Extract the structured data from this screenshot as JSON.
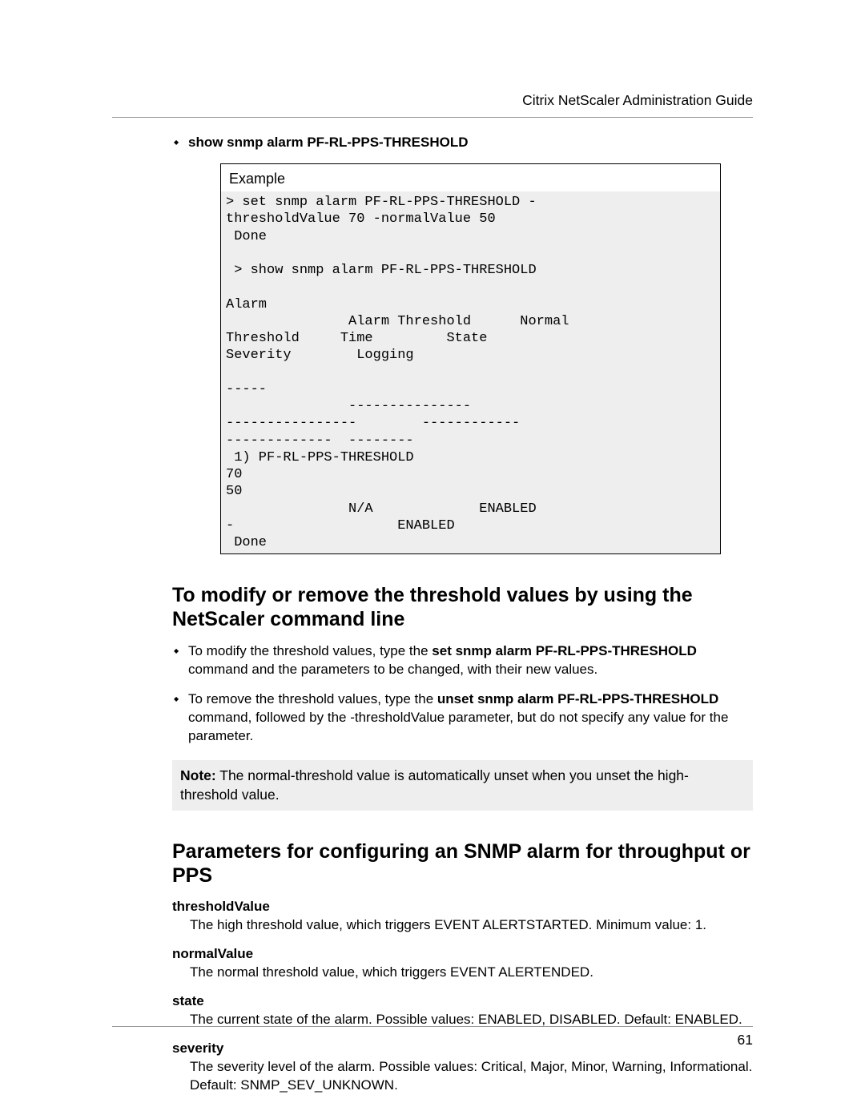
{
  "header": "Citrix NetScaler Administration Guide",
  "top_bullet": "show snmp alarm PF-RL-PPS-THRESHOLD",
  "example": {
    "label": "Example",
    "code": "> set snmp alarm PF-RL-PPS-THRESHOLD -\nthresholdValue 70 -normalValue 50\n Done\n\n > show snmp alarm PF-RL-PPS-THRESHOLD\n\nAlarm                                            \n               Alarm Threshold      Normal \nThreshold     Time         State         \nSeverity        Logging\n\n-----                                               \n               ---------------       \n----------------        ------------    \n-------------  --------\n 1) PF-RL-PPS-THRESHOLD                   \n70                                 \n50                                  \n               N/A             ENABLED       \n-                    ENABLED\n Done"
  },
  "section1": {
    "title": "To modify or remove the threshold values by using the NetScaler command line",
    "b1_pre": "To modify the threshold values, type the ",
    "b1_cmd": "set snmp alarm PF-RL-PPS-THRESHOLD",
    "b1_post": " command and the parameters to be changed, with their new values.",
    "b2_pre": "To remove the threshold values, type the ",
    "b2_cmd": "unset snmp alarm PF-RL-PPS-THRESHOLD",
    "b2_post": " command, followed by the -thresholdValue parameter, but do not specify any value for the parameter."
  },
  "note": {
    "label": "Note:",
    "text": " The normal-threshold value is automatically unset when you unset the high-threshold value."
  },
  "section2": {
    "title": "Parameters for configuring an SNMP alarm for throughput or PPS",
    "params": [
      {
        "term": "thresholdValue",
        "desc": "The high threshold value, which triggers EVENT ALERTSTARTED. Minimum value: 1."
      },
      {
        "term": "normalValue",
        "desc": "The normal threshold value, which triggers EVENT ALERTENDED."
      },
      {
        "term": "state",
        "desc": "The current state of the alarm. Possible values: ENABLED, DISABLED. Default: ENABLED."
      },
      {
        "term": "severity",
        "desc": "The severity level of the alarm. Possible values: Critical, Major, Minor, Warning, Informational. Default: SNMP_SEV_UNKNOWN."
      }
    ]
  },
  "page_number": "61"
}
